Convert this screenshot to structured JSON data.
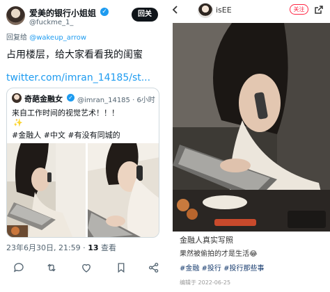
{
  "twitter": {
    "display_name": "爱美的银行小姐姐",
    "handle": "@fuckme_1_",
    "follow_label": "回关",
    "reply_prefix": "回复给 ",
    "reply_handle": "@wakeup_arrow",
    "text": "占用楼层，给大家看看我的闺蜜",
    "link": "twitter.com/imran_14185/st...",
    "quote": {
      "name": "奇葩金融女",
      "handle_time": "@imran_14185 · 6小时",
      "line1": "来自工作时间的视觉艺术！！！",
      "sparkle": "✨",
      "hashtags": "#金融人 #中文 #有没有同城的"
    },
    "timestamp": "23年6月30日, 21:59 · ",
    "views_count": "13",
    "views_label": " 查看",
    "actions": [
      {
        "name": "reply",
        "icon": "comment-icon"
      },
      {
        "name": "retweet",
        "icon": "retweet-icon"
      },
      {
        "name": "like",
        "icon": "heart-icon"
      },
      {
        "name": "bookmark",
        "icon": "bookmark-icon"
      },
      {
        "name": "share",
        "icon": "share-icon"
      }
    ],
    "colors": {
      "accent": "#1d9bf0",
      "text": "#0f1419",
      "muted": "#536471"
    }
  },
  "xhs": {
    "username": "isEE",
    "follow_label": "关注",
    "title": "金融人真实写照",
    "line": "果然被偷拍的才是生活😂",
    "tags": "#金融 #投行 #投行那些事",
    "meta": "编辑于 2022-06-25",
    "colors": {
      "accent": "#ff2442",
      "tag": "#13386c"
    }
  }
}
